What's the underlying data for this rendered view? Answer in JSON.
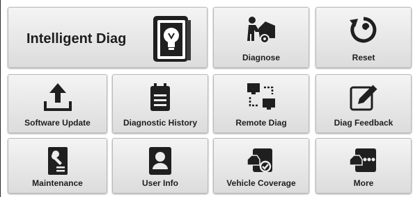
{
  "tiles": {
    "intelligent_diag": "Intelligent Diag",
    "diagnose": "Diagnose",
    "reset": "Reset",
    "software_update": "Software Update",
    "diagnostic_history": "Diagnostic History",
    "remote_diag": "Remote Diag",
    "diag_feedback": "Diag Feedback",
    "maintenance": "Maintenance",
    "user_info": "User Info",
    "vehicle_coverage": "Vehicle Coverage",
    "more": "More"
  },
  "icons": {
    "intelligent_diag": "lightbulb-book-icon",
    "diagnose": "mechanic-car-icon",
    "reset": "reset-wrench-icon",
    "software_update": "upload-icon",
    "diagnostic_history": "clipboard-icon",
    "remote_diag": "remote-screens-icon",
    "diag_feedback": "pencil-feedback-icon",
    "maintenance": "wrench-document-icon",
    "user_info": "user-card-icon",
    "vehicle_coverage": "car-check-icon",
    "more": "car-more-icon"
  },
  "colors": {
    "tile_top": "#f4f4f4",
    "tile_bottom": "#dcdcdc",
    "icon": "#1f1f1f",
    "text": "#1e1e1e"
  }
}
